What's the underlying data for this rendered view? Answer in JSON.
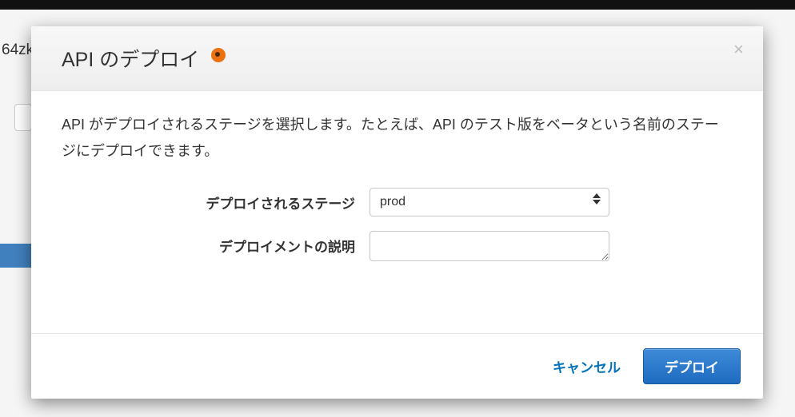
{
  "background": {
    "fragment": "64zk"
  },
  "modal": {
    "title": "API のデプロイ",
    "description": "API がデプロイされるステージを選択します。たとえば、API のテスト版をベータという名前のステージにデプロイできます。",
    "form": {
      "stage_label": "デプロイされるステージ",
      "stage_value": "prod",
      "description_label": "デプロイメントの説明",
      "description_value": ""
    },
    "footer": {
      "cancel": "キャンセル",
      "deploy": "デプロイ"
    }
  }
}
